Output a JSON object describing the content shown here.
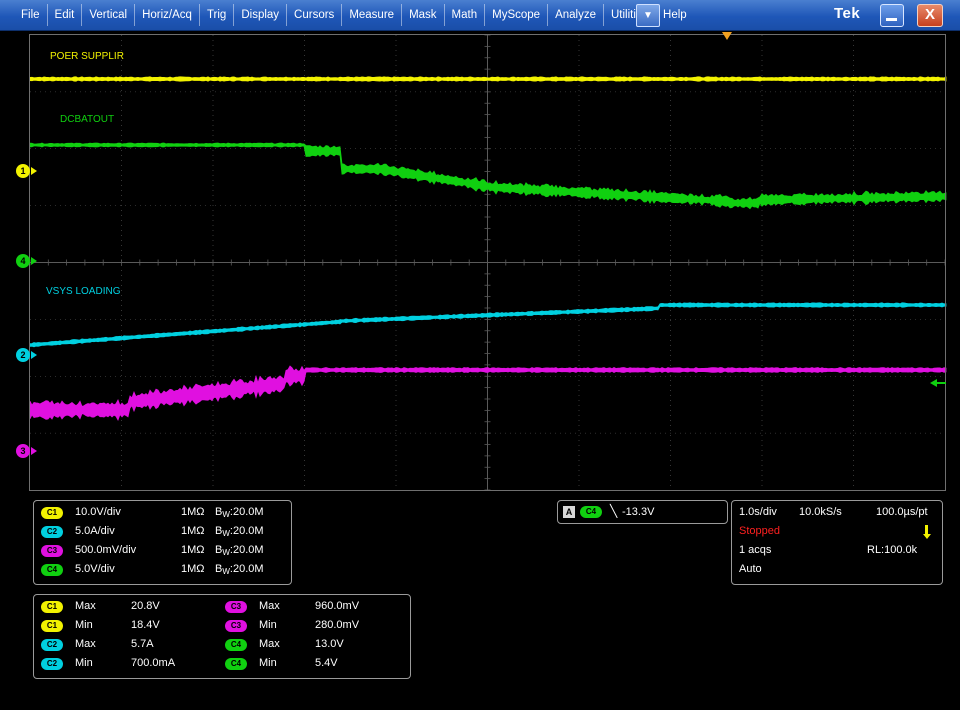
{
  "window": {
    "menu": [
      "File",
      "Edit",
      "Vertical",
      "Horiz/Acq",
      "Trig",
      "Display",
      "Cursors",
      "Measure",
      "Mask",
      "Math",
      "MyScope",
      "Analyze",
      "Utilities",
      "Help"
    ],
    "dropdown_glyph": "▼",
    "brand": "Tek",
    "close_glyph": "X"
  },
  "colors": {
    "ch1": "#f2f200",
    "ch2": "#00d0e0",
    "ch3": "#e010e0",
    "ch4": "#10d010",
    "grid": "#5a5a5a",
    "menubar": "#1f57b8"
  },
  "traces": {
    "ch1_label": "POER SUPPLIR",
    "ch4_label": "DCBATOUT",
    "ch2_label": "VSYS LOADING"
  },
  "markers": {
    "ch1": "1",
    "ch4": "4",
    "ch2": "2",
    "ch3": "3"
  },
  "channels": [
    {
      "badge": "C1",
      "scale": "10.0V/div",
      "impedance": "1MΩ",
      "bw_prefix": "B",
      "bw_sub": "W",
      "bw_value": ":20.0M"
    },
    {
      "badge": "C2",
      "scale": "5.0A/div",
      "impedance": "1MΩ",
      "bw_prefix": "B",
      "bw_sub": "W",
      "bw_value": ":20.0M"
    },
    {
      "badge": "C3",
      "scale": "500.0mV/div",
      "impedance": "1MΩ",
      "bw_prefix": "B",
      "bw_sub": "W",
      "bw_value": ":20.0M"
    },
    {
      "badge": "C4",
      "scale": "5.0V/div",
      "impedance": "1MΩ",
      "bw_prefix": "B",
      "bw_sub": "W",
      "bw_value": ":20.0M"
    }
  ],
  "trigger": {
    "mode_badge": "A",
    "source": "C4",
    "slope_glyph": "╲",
    "level": "-13.3V"
  },
  "acquisition": {
    "timebase": "1.0s/div",
    "sample_rate": "10.0kS/s",
    "resolution": "100.0µs/pt",
    "state": "Stopped",
    "acqs": "1 acqs",
    "record_length": "RL:100.0k",
    "trigger_mode": "Auto"
  },
  "measurements": [
    {
      "badge": "C1",
      "type": "Max",
      "value": "20.8V"
    },
    {
      "badge": "C1",
      "type": "Min",
      "value": "18.4V"
    },
    {
      "badge": "C2",
      "type": "Max",
      "value": "5.7A"
    },
    {
      "badge": "C2",
      "type": "Min",
      "value": "700.0mA"
    },
    {
      "badge": "C3",
      "type": "Max",
      "value": "960.0mV"
    },
    {
      "badge": "C3",
      "type": "Min",
      "value": "280.0mV"
    },
    {
      "badge": "C4",
      "type": "Max",
      "value": "13.0V"
    },
    {
      "badge": "C4",
      "type": "Min",
      "value": "5.4V"
    }
  ]
}
